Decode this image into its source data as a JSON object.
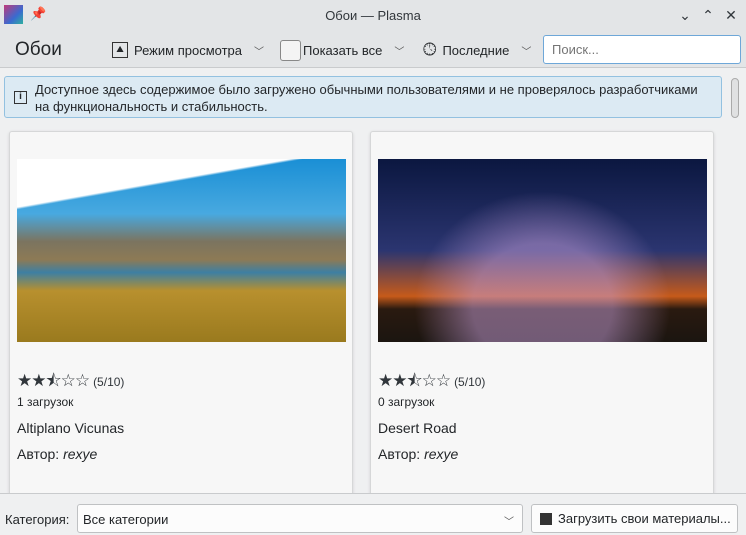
{
  "window": {
    "title": "Обои — Plasma"
  },
  "toolbar": {
    "page_title": "Обои",
    "view_mode": "Режим просмотра",
    "show_all": "Показать все",
    "sort": "Последние",
    "search_placeholder": "Поиск..."
  },
  "banner": {
    "text": "Доступное здесь содержимое было загружено обычными пользователями и не проверялось разработчиками на функциональность и стабильность."
  },
  "items": [
    {
      "name": "Altiplano Vicunas",
      "rating_text": "(5/10)",
      "rating": 5,
      "downloads": "1 загрузок",
      "author_label": "Автор:",
      "author": "rexye"
    },
    {
      "name": "Desert Road",
      "rating_text": "(5/10)",
      "rating": 5,
      "downloads": "0 загрузок",
      "author_label": "Автор:",
      "author": "rexye"
    }
  ],
  "bottom": {
    "category_label": "Категория:",
    "category_value": "Все категории",
    "upload_label": "Загрузить свои материалы..."
  }
}
